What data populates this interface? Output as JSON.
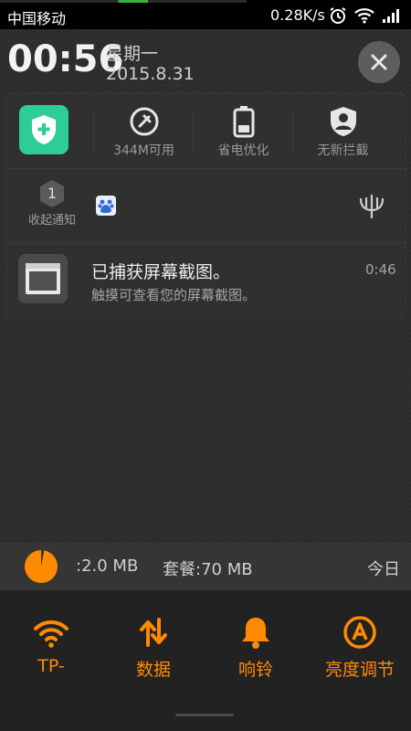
{
  "status_bar": {
    "carrier": "中国移动",
    "net_speed": "0.28K/s",
    "icons": [
      "alarm-icon",
      "wifi-icon",
      "signal-icon"
    ]
  },
  "header": {
    "time": "00:56",
    "weekday": "星期一",
    "date": "2015.8.31",
    "close_icon": "close-icon"
  },
  "quick_actions": [
    {
      "icon": "security-shield-icon",
      "label": ""
    },
    {
      "icon": "memory-clean-icon",
      "label": "344M可用"
    },
    {
      "icon": "battery-icon",
      "label": "省电优化"
    },
    {
      "icon": "block-user-icon",
      "label": "无新拦截"
    }
  ],
  "collapsed": {
    "count": "1",
    "label": "收起通知",
    "app_icon": "baidu-icon",
    "action_icon": "trident-icon"
  },
  "notification": {
    "title": "已捕获屏幕截图。",
    "text": "触摸可查看您的屏幕截图。",
    "time": "0:46",
    "icon": "screenshot-icon"
  },
  "data_usage": {
    "used": ":2.0 MB",
    "plan": "套餐:70 MB",
    "today": "今日",
    "used_fraction": 0.03
  },
  "toggles": [
    {
      "icon": "wifi-icon",
      "label": "TP-"
    },
    {
      "icon": "data-transfer-icon",
      "label": "数据"
    },
    {
      "icon": "bell-icon",
      "label": "响铃"
    },
    {
      "icon": "auto-brightness-icon",
      "label": "亮度调节"
    }
  ],
  "colors": {
    "accent": "#ff8a00",
    "shield": "#2ecc97",
    "background": "#2c2c2c"
  }
}
